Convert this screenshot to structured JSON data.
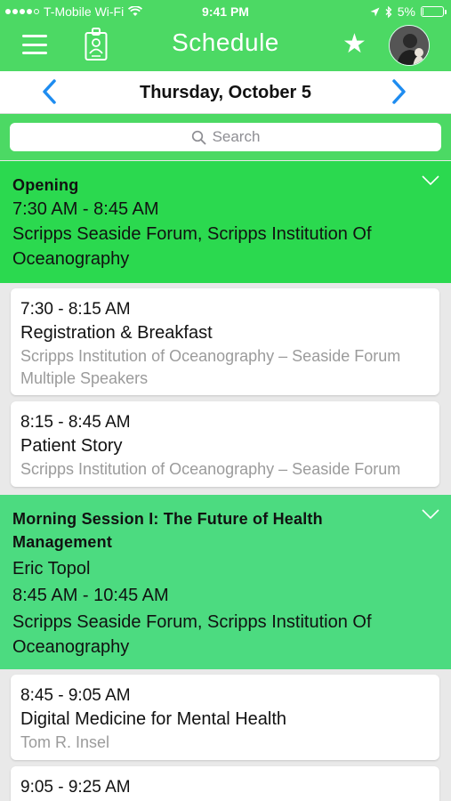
{
  "status_bar": {
    "carrier": "T-Mobile Wi-Fi",
    "time": "9:41 PM",
    "battery": "5%",
    "battery_level": 0.05
  },
  "nav": {
    "title": "Schedule",
    "icons": [
      "menu-icon",
      "badge-icon",
      "star-icon",
      "avatar"
    ]
  },
  "date_bar": {
    "date": "Thursday, October 5",
    "accent": "#1e8cf0"
  },
  "search": {
    "placeholder": "Search"
  },
  "colors": {
    "brand_green": "#4cd964",
    "section_green_active": "#2bd94f",
    "section_green": "#4cdb80",
    "muted_text": "#9b9b9b"
  },
  "sections": [
    {
      "title": "Opening",
      "time": "7:30 AM - 8:45 AM",
      "location": "Scripps Seaside Forum, Scripps Institution Of Oceanography",
      "sessions": [
        {
          "time": "7:30 - 8:15 AM",
          "title": "Registration & Breakfast",
          "location": "Scripps Institution of Oceanography – Seaside Forum",
          "speakers": "Multiple Speakers"
        },
        {
          "time": "8:15 - 8:45 AM",
          "title": "Patient Story",
          "location": "Scripps Institution of Oceanography – Seaside Forum"
        }
      ]
    },
    {
      "title": "Morning Session I: The Future of Health Management",
      "speaker": "Eric Topol",
      "time": "8:45 AM - 10:45 AM",
      "location": "Scripps Seaside Forum, Scripps Institution Of Oceanography",
      "sessions": [
        {
          "time": "8:45 - 9:05 AM",
          "title": "Digital Medicine for Mental Health",
          "speakers": "Tom R. Insel"
        },
        {
          "time": "9:05 - 9:25 AM"
        }
      ]
    }
  ]
}
